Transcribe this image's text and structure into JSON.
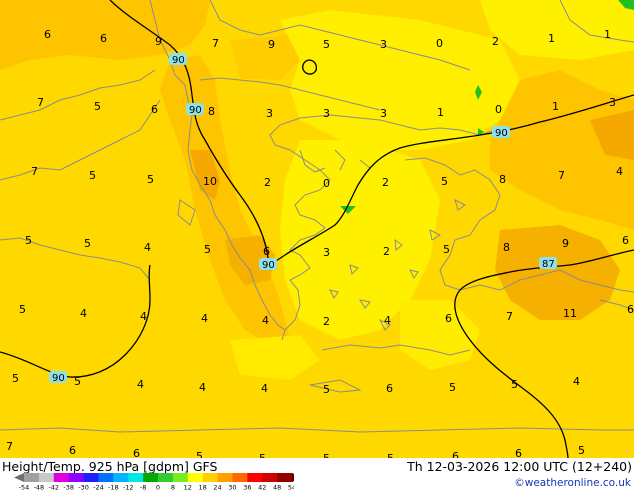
{
  "map": {
    "colors": {
      "base": "#ffd800",
      "light_yellow": "#fff000",
      "orange": "#ffc400",
      "dark_orange": "#f5a800",
      "border_line": "#8c8c8c",
      "contour": "#000000",
      "contour_label_bg": "#8ee0ea"
    },
    "temperature_labels": [
      "6",
      "6",
      "9",
      "7",
      "9",
      "5",
      "3",
      "0",
      "2",
      "1",
      "1",
      "7",
      "5",
      "6",
      "8",
      "3",
      "3",
      "3",
      "1",
      "0",
      "1",
      "3",
      "7",
      "5",
      "5",
      "10",
      "2",
      "0",
      "2",
      "5",
      "8",
      "7",
      "4",
      "5",
      "5",
      "4",
      "5",
      "6",
      "3",
      "2",
      "5",
      "8",
      "9",
      "6",
      "5",
      "4",
      "4",
      "4",
      "4",
      "2",
      "4",
      "6",
      "7",
      "11",
      "6",
      "5",
      "5",
      "4",
      "4",
      "4",
      "5",
      "6",
      "5",
      "5",
      "4",
      "7",
      "6",
      "6",
      "5",
      "5",
      "5",
      "5",
      "6",
      "6",
      "5",
      "5"
    ],
    "contour_labels": [
      "90",
      "90",
      "90",
      "90",
      "90",
      "87"
    ]
  },
  "footer": {
    "title": "Height/Temp. 925 hPa [gdpm] GFS",
    "timestamp": "Th 12-03-2026 12:00 UTC (12+240)",
    "credit": "©weatheronline.co.uk",
    "colorbar_ticks": [
      "-54",
      "-48",
      "-42",
      "-38",
      "-30",
      "-24",
      "-18",
      "-12",
      "-8",
      "0",
      "8",
      "12",
      "18",
      "24",
      "30",
      "36",
      "42",
      "48",
      "54"
    ],
    "colorbar_colors": [
      "#6e6e6e",
      "#a0a0a0",
      "#c8c8c8",
      "#e000e0",
      "#9000ff",
      "#2020ff",
      "#0070ff",
      "#00b4ff",
      "#00e6e6",
      "#00aa00",
      "#33cc33",
      "#77ee22",
      "#ffff00",
      "#ffd000",
      "#ffa000",
      "#ff6a00",
      "#ff0000",
      "#d00000",
      "#900000",
      "#5a0000"
    ]
  }
}
